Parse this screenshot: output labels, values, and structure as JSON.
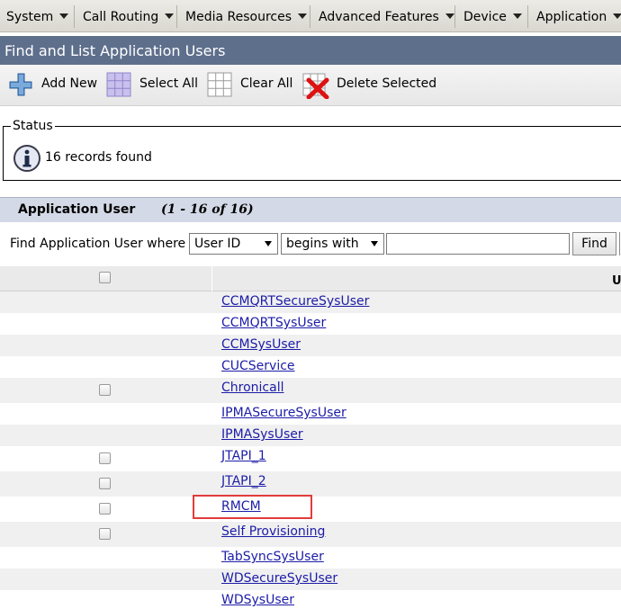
{
  "menu": {
    "items": [
      {
        "label": "System"
      },
      {
        "label": "Call Routing"
      },
      {
        "label": "Media Resources"
      },
      {
        "label": "Advanced Features"
      },
      {
        "label": "Device"
      },
      {
        "label": "Application"
      }
    ]
  },
  "page": {
    "title": "Find and List Application Users"
  },
  "toolbar": {
    "add_new": "Add New",
    "select_all": "Select All",
    "clear_all": "Clear All",
    "delete_selected": "Delete Selected"
  },
  "status": {
    "legend": "Status",
    "message": "16 records found",
    "icon": "info-icon"
  },
  "section": {
    "name": "Application User",
    "range": "(1 - 16 of 16)"
  },
  "search": {
    "lead": "Find Application User where",
    "field": "User ID",
    "operator": "begins with",
    "value": "",
    "button": "Find"
  },
  "table": {
    "header_partial": "U",
    "rows": [
      {
        "user": "CCMQRTSecureSysUser",
        "checkbox": false
      },
      {
        "user": "CCMQRTSysUser",
        "checkbox": false
      },
      {
        "user": "CCMSysUser",
        "checkbox": false
      },
      {
        "user": "CUCService",
        "checkbox": false
      },
      {
        "user": "Chronicall",
        "checkbox": true
      },
      {
        "user": "IPMASecureSysUser",
        "checkbox": false
      },
      {
        "user": "IPMASysUser",
        "checkbox": false
      },
      {
        "user": "JTAPI_1",
        "checkbox": true
      },
      {
        "user": "JTAPI_2",
        "checkbox": true
      },
      {
        "user": "RMCM",
        "checkbox": true
      },
      {
        "user": "Self Provisioning",
        "checkbox": true
      },
      {
        "user": "TabSyncSysUser",
        "checkbox": false
      },
      {
        "user": "WDSecureSysUser",
        "checkbox": false
      },
      {
        "user": "WDSysUser",
        "checkbox": false
      }
    ]
  },
  "colors": {
    "title_bar": "#5e6f8c",
    "section_bar": "#d3d9e6",
    "link": "#1c1ca8",
    "highlight": "#e23b3b"
  }
}
